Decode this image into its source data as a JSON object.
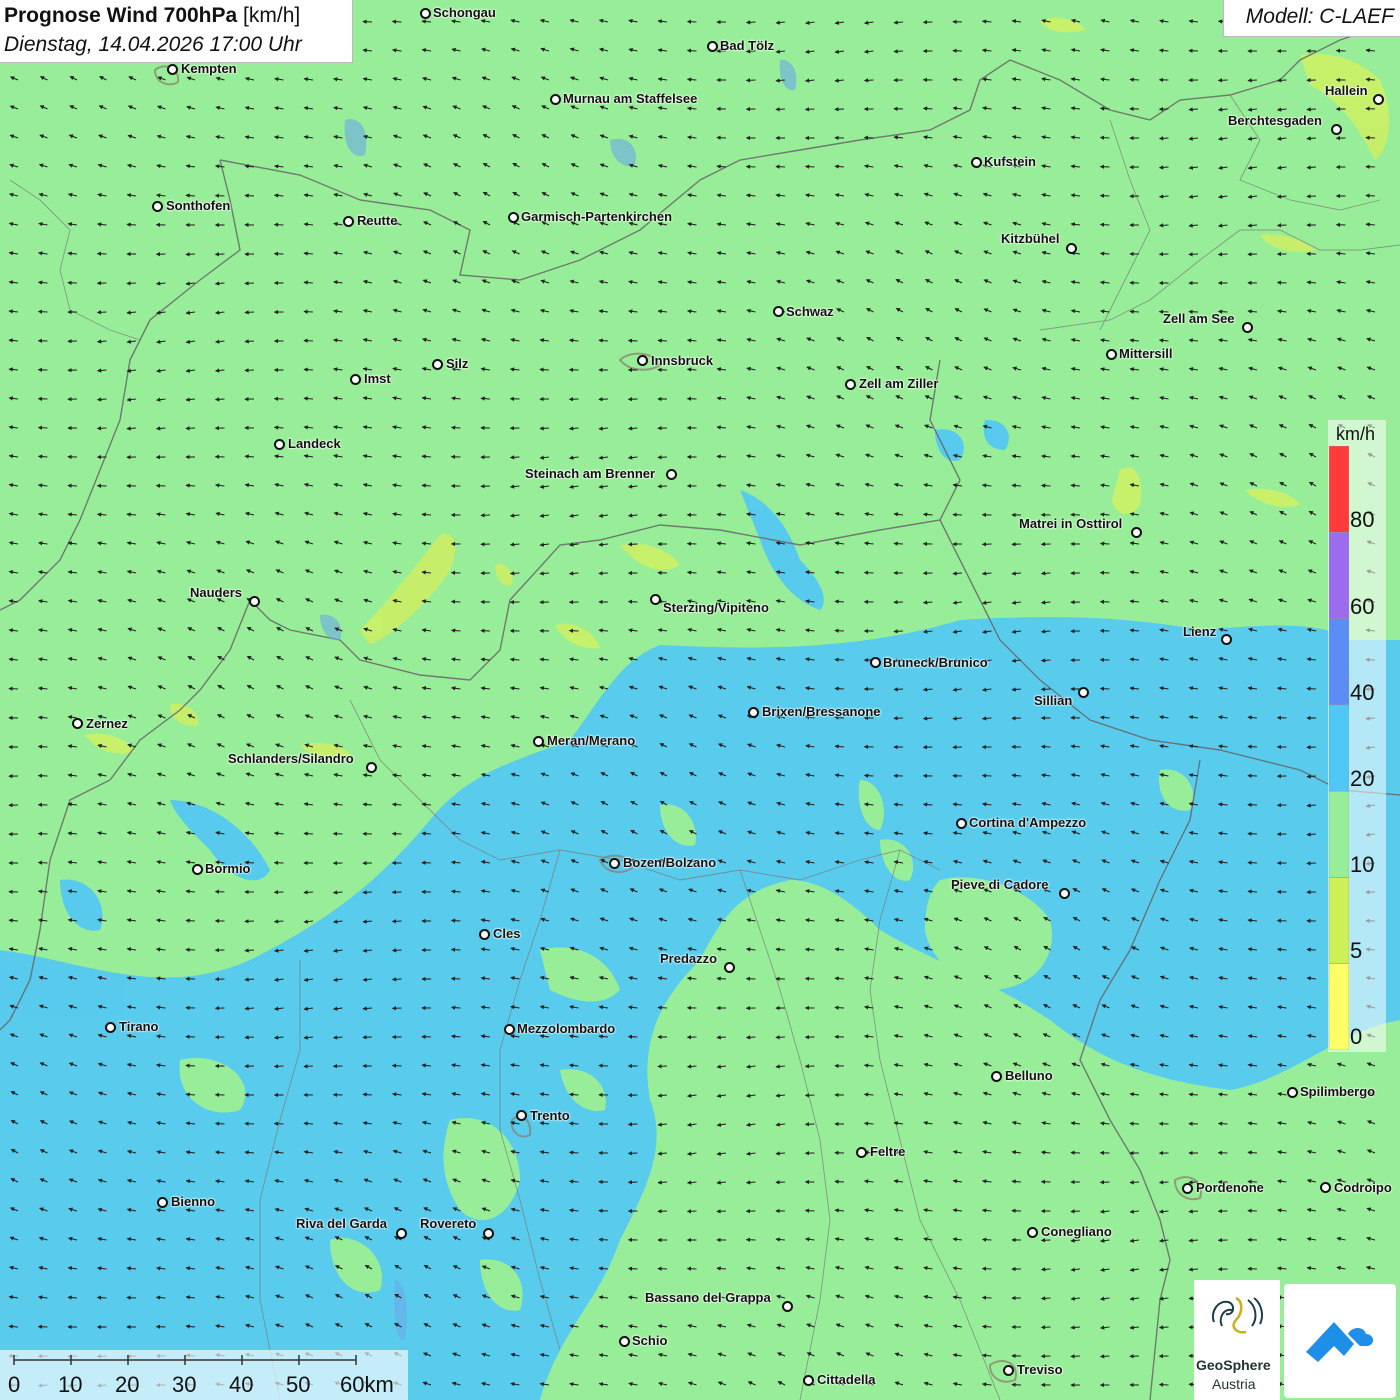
{
  "header": {
    "title_bold": "Prognose Wind 700hPa",
    "title_unit": " [km/h]",
    "datetime": "Dienstag, 14.04.2026 17:00 Uhr",
    "model": "Modell: C-LAEF"
  },
  "legend": {
    "unit": "km/h",
    "bands": [
      {
        "from": 0,
        "to": 5,
        "color": "#ffff66"
      },
      {
        "from": 5,
        "to": 10,
        "color": "#ccf055"
      },
      {
        "from": 10,
        "to": 20,
        "color": "#98ee98"
      },
      {
        "from": 20,
        "to": 40,
        "color": "#4fc8f5"
      },
      {
        "from": 40,
        "to": 60,
        "color": "#5b8df5"
      },
      {
        "from": 60,
        "to": 80,
        "color": "#9b6cf0"
      },
      {
        "from": 80,
        "to": 100,
        "color": "#ff3b3b"
      }
    ],
    "labels": [
      "80",
      "60",
      "40",
      "20",
      "10",
      "5",
      "0"
    ]
  },
  "scale_bar": {
    "labels": [
      "0",
      "10",
      "20",
      "30",
      "40",
      "50",
      "60km"
    ]
  },
  "logos": {
    "geosphere_line1": "GeoSphere",
    "geosphere_line2": "Austria"
  },
  "cities": [
    {
      "name": "Schongau"
    },
    {
      "name": "Bad Tölz"
    },
    {
      "name": "Kempten"
    },
    {
      "name": "Murnau am Staffelsee"
    },
    {
      "name": "Hallein"
    },
    {
      "name": "Berchtesgaden"
    },
    {
      "name": "Kufstein"
    },
    {
      "name": "Sonthofen"
    },
    {
      "name": "Reutte"
    },
    {
      "name": "Garmisch-Partenkirchen"
    },
    {
      "name": "Kitzbühel"
    },
    {
      "name": "Schwaz"
    },
    {
      "name": "Zell am See"
    },
    {
      "name": "Mittersill"
    },
    {
      "name": "Silz"
    },
    {
      "name": "Innsbruck"
    },
    {
      "name": "Imst"
    },
    {
      "name": "Zell am Ziller"
    },
    {
      "name": "Landeck"
    },
    {
      "name": "Steinach am Brenner"
    },
    {
      "name": "Matrei in Osttirol"
    },
    {
      "name": "Nauders"
    },
    {
      "name": "Sterzing/Vipiteno"
    },
    {
      "name": "Lienz"
    },
    {
      "name": "Bruneck/Brunico"
    },
    {
      "name": "Sillian"
    },
    {
      "name": "Zernez"
    },
    {
      "name": "Brixen/Bressanone"
    },
    {
      "name": "Meran/Merano"
    },
    {
      "name": "Schlanders/Silandro"
    },
    {
      "name": "Cortina d'Ampezzo"
    },
    {
      "name": "Bormio"
    },
    {
      "name": "Bozen/Bolzano"
    },
    {
      "name": "Pieve di Cadore"
    },
    {
      "name": "Cles"
    },
    {
      "name": "Predazzo"
    },
    {
      "name": "Tirano"
    },
    {
      "name": "Mezzolombardo"
    },
    {
      "name": "Belluno"
    },
    {
      "name": "Spilimbergo"
    },
    {
      "name": "Trento"
    },
    {
      "name": "Feltre"
    },
    {
      "name": "Bienno"
    },
    {
      "name": "Pordenone"
    },
    {
      "name": "Codroipo"
    },
    {
      "name": "Riva del Garda"
    },
    {
      "name": "Rovereto"
    },
    {
      "name": "Conegliano"
    },
    {
      "name": "Bassano del Grappa"
    },
    {
      "name": "Schio"
    },
    {
      "name": "Treviso"
    },
    {
      "name": "Cittadella"
    }
  ]
}
